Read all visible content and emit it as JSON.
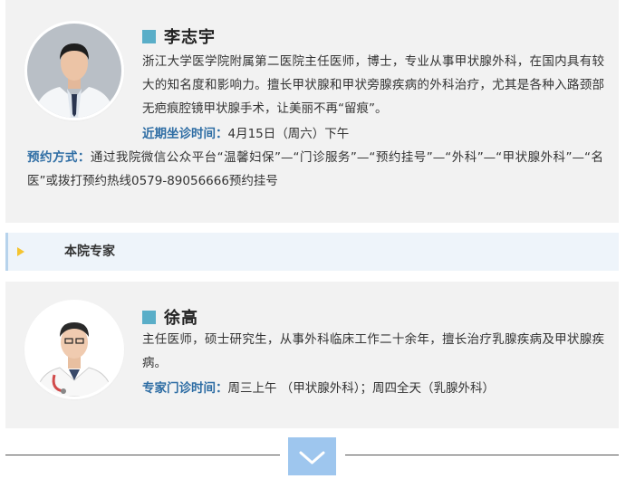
{
  "doctor1": {
    "name": "李志宇",
    "bio": "浙江大学医学院附属第二医院主任医师，博士，专业从事甲状腺外科，在国内具有较大的知名度和影响力。擅长甲状腺和甲状旁腺疾病的外科治疗，尤其是各种入路颈部无疤痕腔镜甲状腺手术，让美丽不再“留痕”。",
    "time_label": "近期坐诊时间：",
    "time_value": "4月15日（周六）下午",
    "appt_label": "预约方式：",
    "appt_value": "通过我院微信公众平台“温馨妇保”—“门诊服务”—“预约挂号”—“外科”—“甲状腺外科”—“名医”或拨打预约热线0579-89056666预约挂号"
  },
  "section": {
    "title": "本院专家"
  },
  "doctor2": {
    "name": "徐高",
    "bio": "主任医师，硕士研究生，从事外科临床工作二十余年，擅长治疗乳腺疾病及甲状腺疾病。",
    "time_label": "专家门诊时间：",
    "time_value": "周三上午 （甲状腺外科）；周四全天（乳腺外科）"
  },
  "icons": {
    "expand": "chevron-down-icon",
    "marker": "triangle-icon"
  },
  "colors": {
    "accent_square": "#5aaec8",
    "label_blue": "#2e6da4",
    "button": "#9ec6ee",
    "marker": "#f4c430"
  }
}
